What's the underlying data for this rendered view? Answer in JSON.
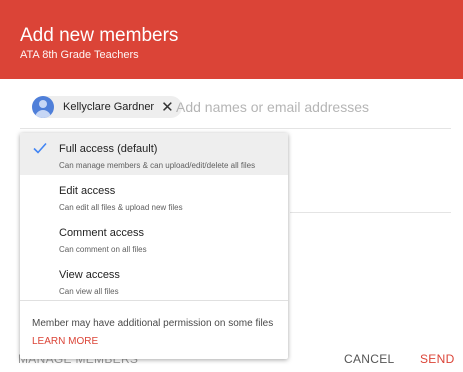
{
  "dialog": {
    "title": "Add new members",
    "subtitle": "ATA 8th Grade Teachers"
  },
  "recipients": {
    "chips": [
      {
        "name": "Kellyclare Gardner",
        "remove_icon": "close-icon"
      }
    ],
    "placeholder": "Add names or email addresses"
  },
  "access_menu": {
    "items": [
      {
        "label": "Full access (default)",
        "description": "Can manage members & can upload/edit/delete all files",
        "selected": true
      },
      {
        "label": "Edit access",
        "description": "Can edit all files & upload new files",
        "selected": false
      },
      {
        "label": "Comment access",
        "description": "Can comment on all files",
        "selected": false
      },
      {
        "label": "View access",
        "description": "Can view all files",
        "selected": false
      }
    ],
    "note": "Member may have additional permission on some files",
    "learn_more": "LEARN MORE"
  },
  "footer": {
    "manage_label": "MANAGE MEMBERS",
    "cancel_label": "CANCEL",
    "send_label": "SEND"
  },
  "colors": {
    "accent": "#db4437",
    "check": "#4285f4",
    "avatar": "#4f7fd9"
  },
  "icons": {
    "selected_mark": "checkmark-icon",
    "chip_remove": "close-icon",
    "avatar": "avatar-icon"
  }
}
